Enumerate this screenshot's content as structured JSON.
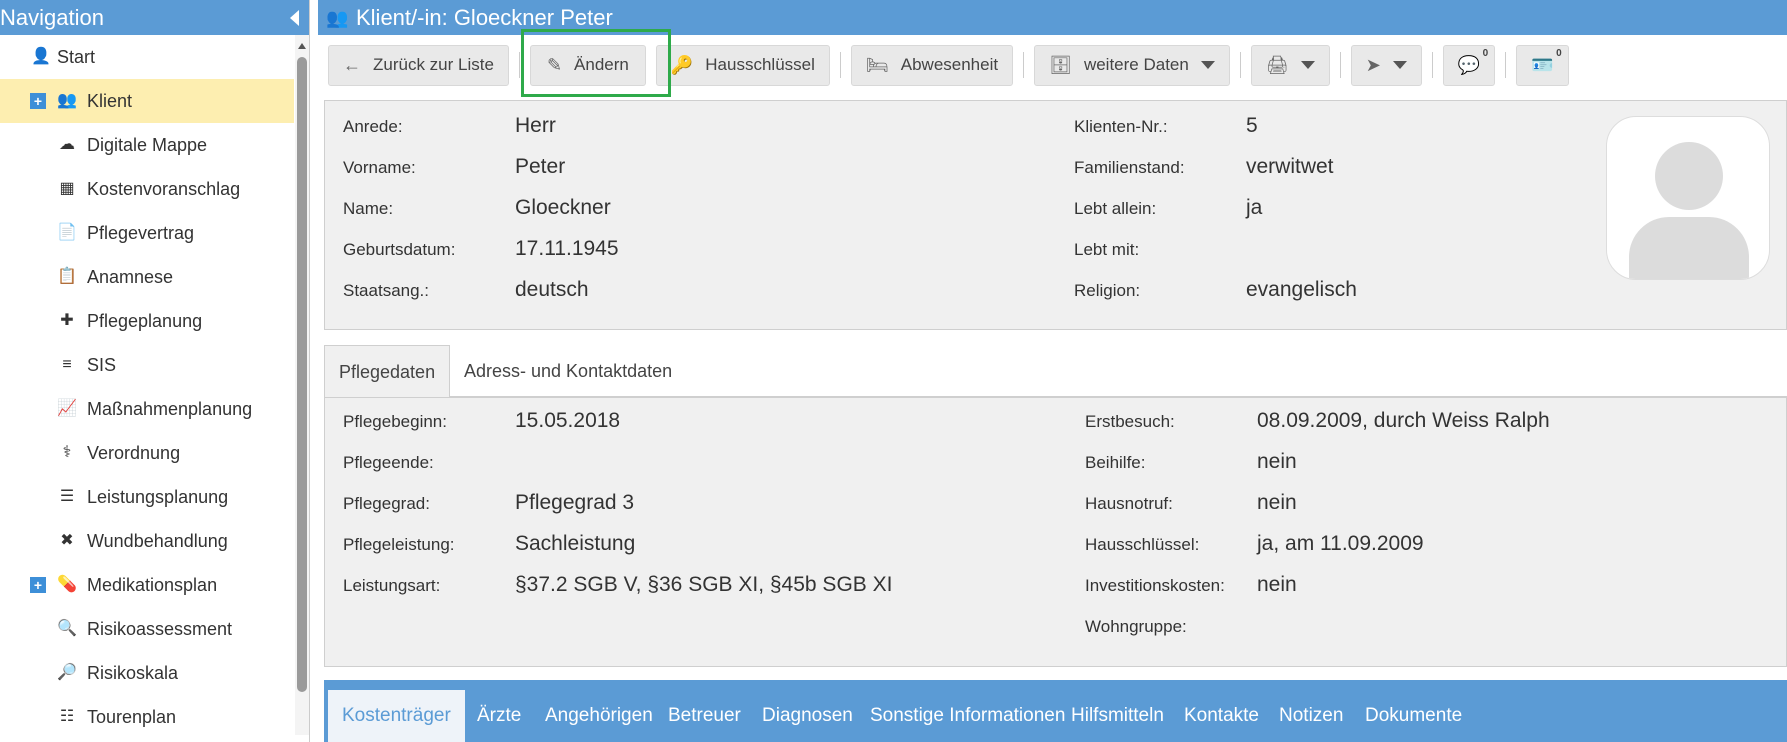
{
  "sidebar": {
    "title": "Navigation",
    "items": [
      {
        "label": "Start",
        "icon": "user-icon"
      },
      {
        "label": "Klient",
        "icon": "clients-icon"
      },
      {
        "label": "Digitale Mappe",
        "icon": "cloud-icon"
      },
      {
        "label": "Kostenvoranschlag",
        "icon": "calculator-icon"
      },
      {
        "label": "Pflegevertrag",
        "icon": "contract-icon"
      },
      {
        "label": "Anamnese",
        "icon": "clipboard-icon"
      },
      {
        "label": "Pflegeplanung",
        "icon": "medical-plan-icon"
      },
      {
        "label": "SIS",
        "icon": "document-icon"
      },
      {
        "label": "Maßnahmenplanung",
        "icon": "measures-icon"
      },
      {
        "label": "Verordnung",
        "icon": "stethoscope-icon"
      },
      {
        "label": "Leistungsplanung",
        "icon": "list-clipboard-icon"
      },
      {
        "label": "Wundbehandlung",
        "icon": "bandage-icon"
      },
      {
        "label": "Medikationsplan",
        "icon": "medication-icon"
      },
      {
        "label": "Risikoassessment",
        "icon": "magnifier-alert-icon"
      },
      {
        "label": "Risikoskala",
        "icon": "magnifier-plus-icon"
      },
      {
        "label": "Tourenplan",
        "icon": "tour-icon"
      }
    ]
  },
  "header": {
    "title": "Klient/-in: Gloeckner Peter"
  },
  "toolbar": {
    "back": "Zurück zur Liste",
    "edit": "Ändern",
    "key": "Hausschlüssel",
    "absence": "Abwesenheit",
    "more": "weitere Daten",
    "comments_count": "0",
    "card_count": "0"
  },
  "client": {
    "anrede_label": "Anrede:",
    "anrede": "Herr",
    "vorname_label": "Vorname:",
    "vorname": "Peter",
    "name_label": "Name:",
    "name": "Gloeckner",
    "geburt_label": "Geburtsdatum:",
    "geburt": "17.11.1945",
    "staat_label": "Staatsang.:",
    "staat": "deutsch",
    "nr_label": "Klienten-Nr.:",
    "nr": "5",
    "familie_label": "Familienstand:",
    "familie": "verwitwet",
    "allein_label": "Lebt allein:",
    "allein": "ja",
    "mit_label": "Lebt mit:",
    "mit": "",
    "religion_label": "Religion:",
    "religion": "evangelisch"
  },
  "tabs": {
    "pflege": "Pflegedaten",
    "adresse": "Adress- und Kontaktdaten"
  },
  "care": {
    "beginn_label": "Pflegebeginn:",
    "beginn": "15.05.2018",
    "ende_label": "Pflegeende:",
    "ende": "",
    "grad_label": "Pflegegrad:",
    "grad": "Pflegegrad 3",
    "leistung_label": "Pflegeleistung:",
    "leistung": "Sachleistung",
    "art_label": "Leistungsart:",
    "art": "§37.2 SGB V, §36 SGB XI, §45b SGB XI",
    "erst_label": "Erstbesuch:",
    "erst": "08.09.2009, durch Weiss Ralph",
    "beihilfe_label": "Beihilfe:",
    "beihilfe": "nein",
    "notruf_label": "Hausnotruf:",
    "notruf": "nein",
    "schluessel_label": "Hausschlüssel:",
    "schluessel": "ja, am 11.09.2009",
    "invest_label": "Investitionskosten:",
    "invest": "nein",
    "wohn_label": "Wohngruppe:",
    "wohn": ""
  },
  "bottom_tabs": [
    "Kostenträger",
    "Ärzte",
    "Angehörigen",
    "Betreuer",
    "Diagnosen",
    "Sonstige Informationen",
    "Hilfsmitteln",
    "Kontakte",
    "Notizen",
    "Dokumente"
  ],
  "colors": {
    "primary": "#5b9bd5",
    "active_nav": "#fdeeb0",
    "highlight": "#2eaa4a"
  }
}
